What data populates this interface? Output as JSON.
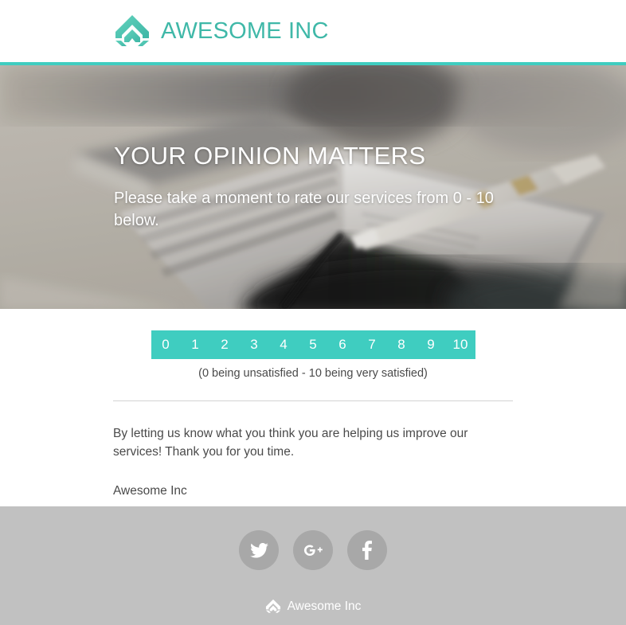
{
  "header": {
    "brand_name": "AWESOME INC",
    "logo_icon": "awesome-inc-chevron-logo",
    "accent_color": "#3fb8a8",
    "rule_color": "#3fcdc0"
  },
  "hero": {
    "title": "YOUR OPINION MATTERS",
    "subtitle": "Please take a moment to rate our services from 0 - 10 below.",
    "image_description": "blurred photo of an open notebook planner with a pen resting on it"
  },
  "rating": {
    "options": [
      "0",
      "1",
      "2",
      "3",
      "4",
      "5",
      "6",
      "7",
      "8",
      "9",
      "10"
    ],
    "legend": "(0 being unsatisfied - 10 being very satisfied)",
    "scale_color": "#3fcdc0"
  },
  "content": {
    "body": "By letting us know what you think you are helping us improve our services! Thank you for you time.",
    "signature": "Awesome Inc"
  },
  "footer": {
    "background_color": "#c1c1c1",
    "social": [
      {
        "name": "twitter",
        "label": "Twitter",
        "icon": "twitter-icon"
      },
      {
        "name": "googleplus",
        "label": "Google Plus",
        "icon": "google-plus-icon"
      },
      {
        "name": "facebook",
        "label": "Facebook",
        "icon": "facebook-icon"
      }
    ],
    "brand_name": "Awesome Inc",
    "logo_icon": "awesome-inc-chevron-logo-small"
  }
}
